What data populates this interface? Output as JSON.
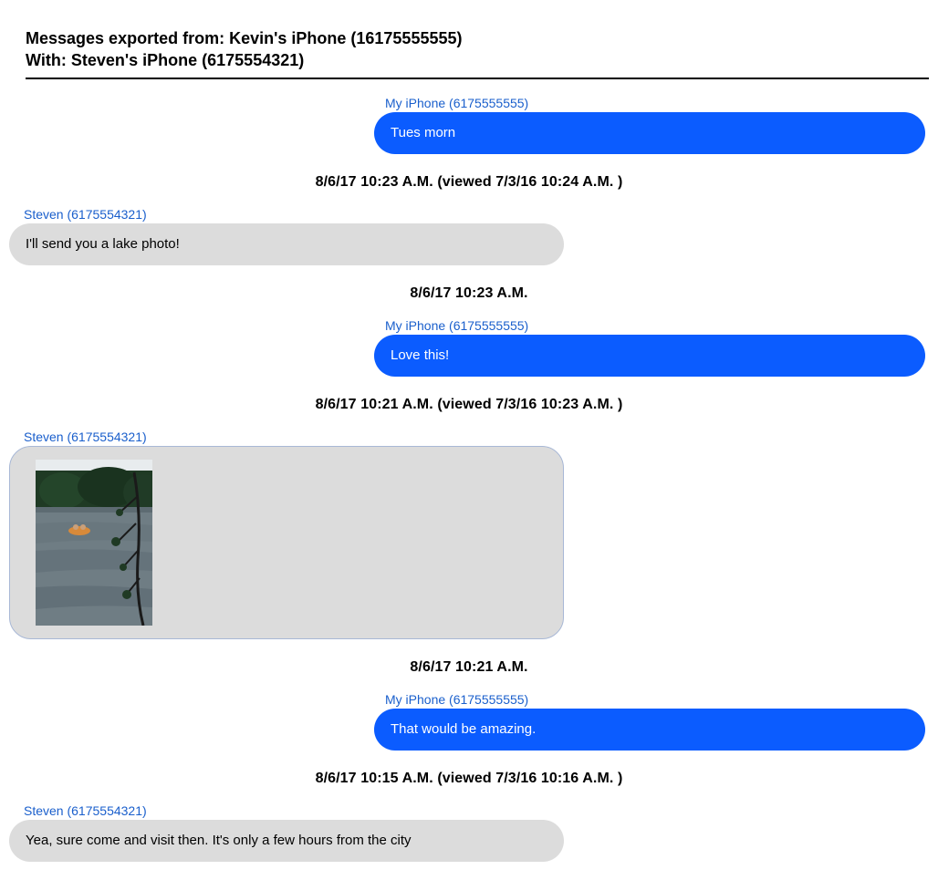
{
  "header": {
    "line1": "Messages exported from: Kevin's iPhone (16175555555)",
    "line2": "With: Steven's iPhone (6175554321)"
  },
  "labels": {
    "out": "My iPhone (6175555555)",
    "in": "Steven (6175554321)"
  },
  "messages": {
    "m1_text": "Tues morn",
    "ts1": "8/6/17 10:23 A.M. (viewed 7/3/16 10:24 A.M. )",
    "m2_text": "I'll send you a lake photo!",
    "ts2": "8/6/17 10:23 A.M.",
    "m3_text": "Love this!",
    "ts3": "8/6/17 10:21 A.M. (viewed 7/3/16 10:23 A.M. )",
    "m4_alt": "lake-photo",
    "ts4": "8/6/17 10:21 A.M.",
    "m5_text": "That would be amazing.",
    "ts5": "8/6/17 10:15 A.M. (viewed 7/3/16 10:16 A.M. )",
    "m6_text": "Yea, sure come and visit then. It's only a few hours from the city"
  }
}
